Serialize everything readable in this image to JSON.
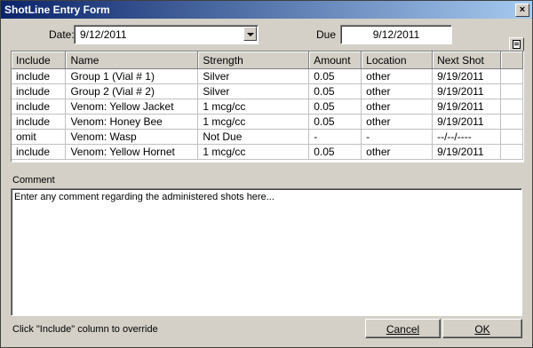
{
  "window": {
    "title": "ShotLine Entry Form",
    "close_glyph": "×"
  },
  "form": {
    "date_label": "Date:",
    "date_value": "9/12/2011",
    "due_label": "Due",
    "due_value": "9/12/2011"
  },
  "table": {
    "columns": [
      "Include",
      "Name",
      "Strength",
      "Amount",
      "Location",
      "Next Shot"
    ],
    "rows": [
      [
        "include",
        "Group 1 (Vial # 1)",
        "Silver",
        "0.05",
        "other",
        "9/19/2011"
      ],
      [
        "include",
        "Group 2 (Vial # 2)",
        "Silver",
        "0.05",
        "other",
        "9/19/2011"
      ],
      [
        "include",
        "Venom: Yellow Jacket",
        "1 mcg/cc",
        "0.05",
        "other",
        "9/19/2011"
      ],
      [
        "include",
        "Venom: Honey Bee",
        "1 mcg/cc",
        "0.05",
        "other",
        "9/19/2011"
      ],
      [
        "omit",
        "Venom: Wasp",
        "Not Due",
        "-",
        "-",
        "--/--/----"
      ],
      [
        "include",
        "Venom: Yellow Hornet",
        "1 mcg/cc",
        "0.05",
        "other",
        "9/19/2011"
      ]
    ]
  },
  "comment": {
    "label": "Comment",
    "text": "Enter any comment regarding the administered shots here..."
  },
  "footer": {
    "hint": "Click \"Include\" column to override",
    "cancel_label": "Cancel",
    "ok_label": "OK"
  },
  "icons": {
    "export": "export-list-icon",
    "dropdown": "chevron-down-icon",
    "close": "close-icon"
  }
}
